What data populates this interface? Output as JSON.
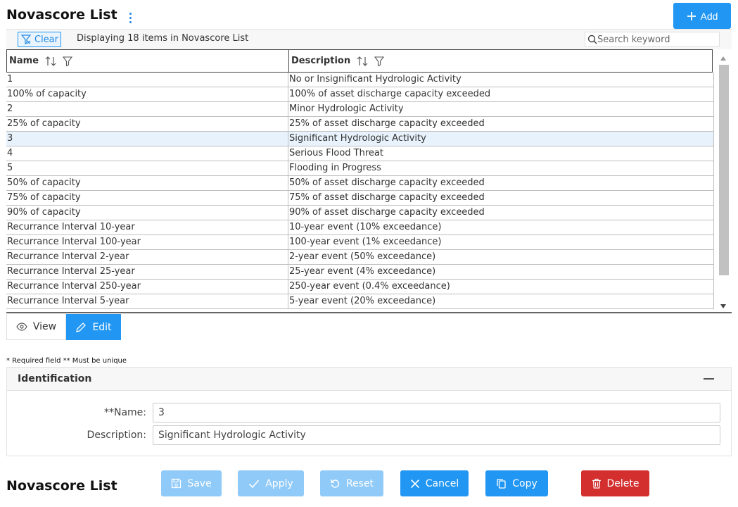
{
  "page": {
    "title": "Novascore List"
  },
  "add_button": {
    "label": "Add"
  },
  "toolbar": {
    "clear_label": "Clear",
    "displaying_text": "Displaying 18 items in Novascore List",
    "search_placeholder": "Search keyword"
  },
  "grid": {
    "columns": [
      "Name",
      "Description"
    ],
    "selected_row": 4,
    "rows": [
      {
        "name": "1",
        "description": "No or Insignificant Hydrologic Activity"
      },
      {
        "name": "100% of capacity",
        "description": "100% of asset discharge capacity exceeded"
      },
      {
        "name": "2",
        "description": "Minor Hydrologic Activity"
      },
      {
        "name": "25% of capacity",
        "description": "25% of asset discharge capacity exceeded"
      },
      {
        "name": "3",
        "description": "Significant Hydrologic Activity"
      },
      {
        "name": "4",
        "description": "Serious Flood Threat"
      },
      {
        "name": "5",
        "description": "Flooding in Progress"
      },
      {
        "name": "50% of capacity",
        "description": "50% of asset discharge capacity exceeded"
      },
      {
        "name": "75% of capacity",
        "description": "75% of asset discharge capacity exceeded"
      },
      {
        "name": "90% of capacity",
        "description": "90% of asset discharge capacity exceeded"
      },
      {
        "name": "Recurrance Interval 10-year",
        "description": "10-year event (10% exceedance)"
      },
      {
        "name": "Recurrance Interval 100-year",
        "description": "100-year event (1% exceedance)"
      },
      {
        "name": "Recurrance Interval 2-year",
        "description": "2-year event (50% exceedance)"
      },
      {
        "name": "Recurrance Interval 25-year",
        "description": "25-year event (4% exceedance)"
      },
      {
        "name": "Recurrance Interval 250-year",
        "description": "250-year event (0.4% exceedance)"
      },
      {
        "name": "Recurrance Interval 5-year",
        "description": "5-year event (20% exceedance)"
      }
    ]
  },
  "mode_tabs": {
    "view_label": "View",
    "edit_label": "Edit",
    "active": "Edit"
  },
  "form": {
    "note": "* Required field ** Must be unique",
    "section_title": "Identification",
    "name_label": "**Name:",
    "name_value": "3",
    "description_label": "Description:",
    "description_value": "Significant Hydrologic Activity"
  },
  "footer": {
    "title": "Novascore List",
    "buttons": {
      "save": "Save",
      "apply": "Apply",
      "reset": "Reset",
      "cancel": "Cancel",
      "copy": "Copy",
      "delete": "Delete"
    }
  },
  "colors": {
    "primary": "#2196f3",
    "primary_disabled": "#90caf9",
    "danger": "#d32f2f",
    "selected_row": "#e8f2fc"
  }
}
